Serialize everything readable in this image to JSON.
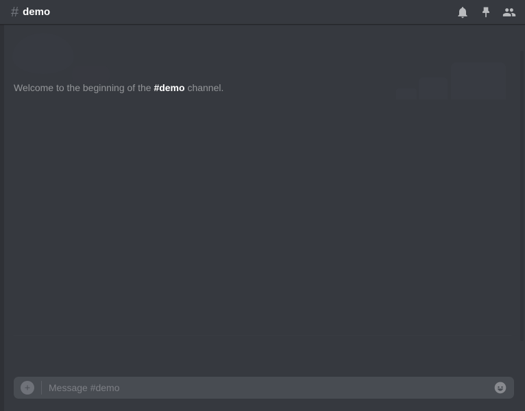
{
  "header": {
    "channel_name": "demo",
    "hash": "#"
  },
  "welcome": {
    "prefix": "Welcome to the beginning of the ",
    "channel": "#demo",
    "suffix": " channel."
  },
  "input": {
    "placeholder": "Message #demo"
  }
}
